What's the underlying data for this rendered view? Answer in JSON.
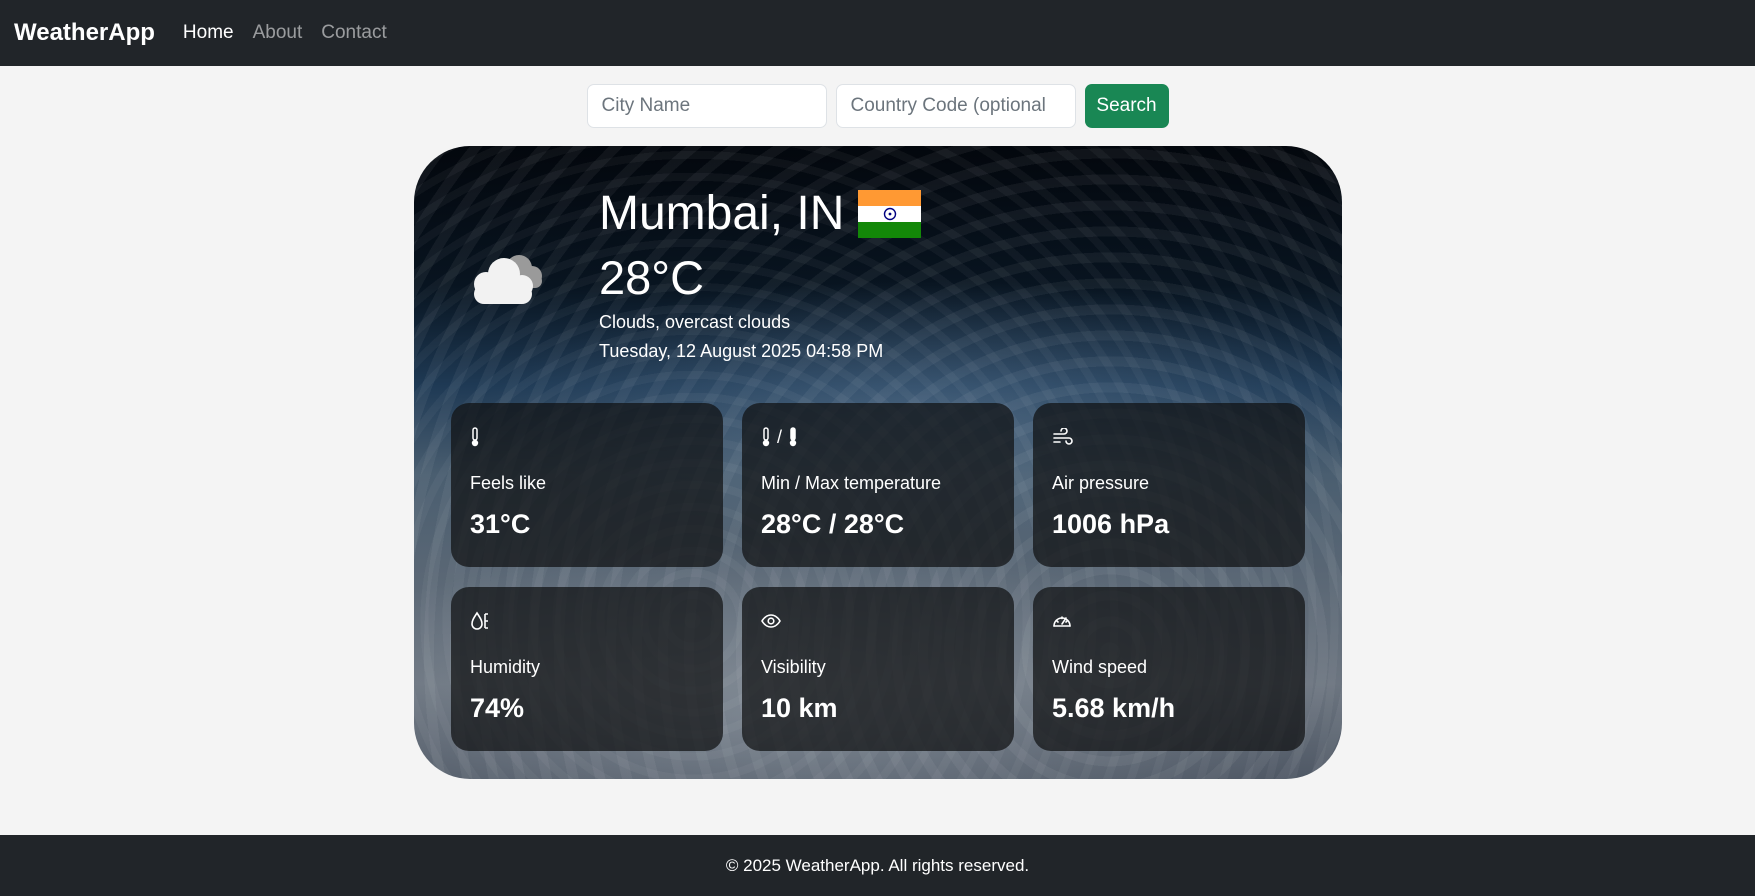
{
  "nav": {
    "brand": "WeatherApp",
    "links": [
      {
        "label": "Home"
      },
      {
        "label": "About"
      },
      {
        "label": "Contact"
      }
    ]
  },
  "search": {
    "city_placeholder": "City Name",
    "country_placeholder": "Country Code (optional",
    "button_label": "Search",
    "button_color": "#198754"
  },
  "weather": {
    "icon": "cloud-icon",
    "city": "Mumbai, IN",
    "flag": "india-flag-icon",
    "temperature": "28°C",
    "description": "Clouds, overcast clouds",
    "datetime": "Tuesday, 12 August 2025 04:58 PM",
    "stats": [
      {
        "icon": "thermometer-icon",
        "label": "Feels like",
        "value": "31°C"
      },
      {
        "icon": "thermometer-range-icon",
        "icon_separator": "/",
        "label": "Min / Max temperature",
        "value": "28°C / 28°C"
      },
      {
        "icon": "wind-icon",
        "label": "Air pressure",
        "value": "1006 hPa"
      },
      {
        "icon": "humidity-icon",
        "label": "Humidity",
        "value": "74%"
      },
      {
        "icon": "eye-icon",
        "label": "Visibility",
        "value": "10 km"
      },
      {
        "icon": "speedometer-icon",
        "label": "Wind speed",
        "value": "5.68 km/h"
      }
    ]
  },
  "footer": {
    "text": "© 2025 WeatherApp. All rights reserved."
  }
}
